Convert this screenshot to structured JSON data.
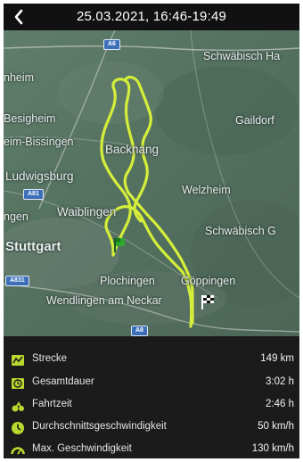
{
  "header": {
    "title": "25.03.2021, 16:46-19:49"
  },
  "map": {
    "places": {
      "schwaebisch_hall": "Schwäbisch Ha",
      "heim": "nheim",
      "bietigheim": "Besigheim",
      "bissingen": "eim-Bissingen",
      "gaildorf": "Gaildorf",
      "backnang": "Backnang",
      "ludwigsburg": "Ludwigsburg",
      "welzheim": "Welzheim",
      "waiblingen": "Waiblingen",
      "ngen": "ngen",
      "schwaebisch_gmuend": "Schwäbisch G",
      "stuttgart": "Stuttgart",
      "plochingen": "Plochingen",
      "goeppingen": "Göppingen",
      "wendlingen": "Wendlingen am Neckar"
    },
    "road_shields": {
      "a6": "A6",
      "a81": "A81",
      "a831": "A831",
      "a8": "A8"
    },
    "route_color": "#d4ee3a",
    "start_marker": "green-flag-icon",
    "finish_marker": "checkered-flag-icon"
  },
  "stats": [
    {
      "icon": "distance-icon",
      "label": "Strecke",
      "value": "149 km"
    },
    {
      "icon": "total-duration-icon",
      "label": "Gesamtdauer",
      "value": "3:02 h"
    },
    {
      "icon": "riding-time-icon",
      "label": "Fahrtzeit",
      "value": "2:46 h"
    },
    {
      "icon": "average-speed-icon",
      "label": "Durchschnittsgeschwindigkeit",
      "value": "50 km/h"
    },
    {
      "icon": "max-speed-icon",
      "label": "Max. Geschwindigkeit",
      "value": "130 km/h"
    }
  ],
  "colors": {
    "accent": "#b9d82e",
    "panel": "#1b1b1b",
    "topbar": "#111111"
  }
}
